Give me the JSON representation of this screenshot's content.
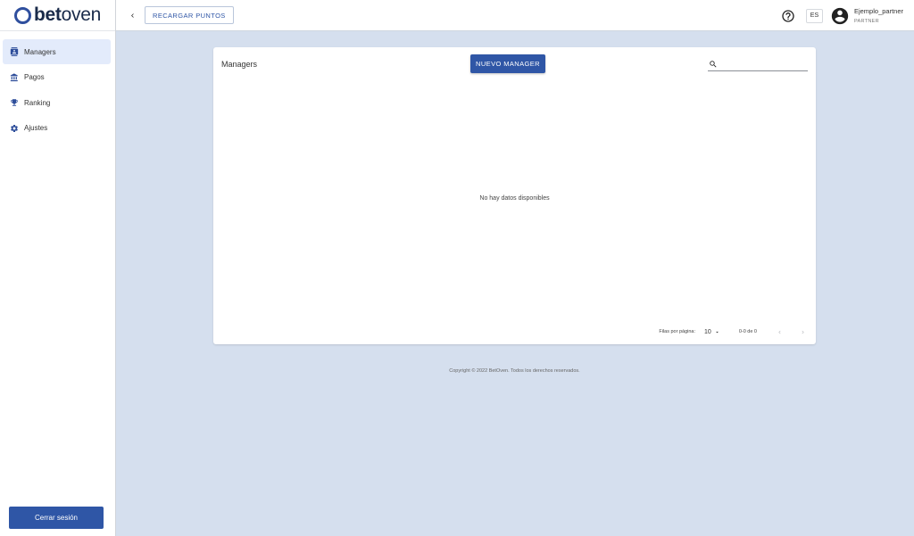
{
  "logo": {
    "bold": "bet",
    "rest": "oven"
  },
  "sidebar": {
    "items": [
      {
        "label": "Managers",
        "icon": "contacts-icon"
      },
      {
        "label": "Pagos",
        "icon": "bank-icon"
      },
      {
        "label": "Ranking",
        "icon": "trophy-icon"
      },
      {
        "label": "Ajustes",
        "icon": "gear-icon"
      }
    ],
    "logout_label": "Cerrar sesión"
  },
  "topbar": {
    "reload_label": "RECARGAR PUNTOS",
    "lang": "ES",
    "user_name": "Ejemplo_partner",
    "user_role": "PARTNER"
  },
  "card": {
    "title": "Managers",
    "new_button": "NUEVO MANAGER",
    "search_placeholder": "",
    "empty_text": "No hay datos disponibles",
    "pager": {
      "rows_label": "Filas por página:",
      "rows_value": "10",
      "range": "0-0 de 0"
    }
  },
  "footer": "Copyright © 2022 BetOven. Todos los derechos reservados.",
  "colors": {
    "accent": "#2f56a6",
    "background": "#d5dfee",
    "active_nav": "#e3ebfb"
  }
}
